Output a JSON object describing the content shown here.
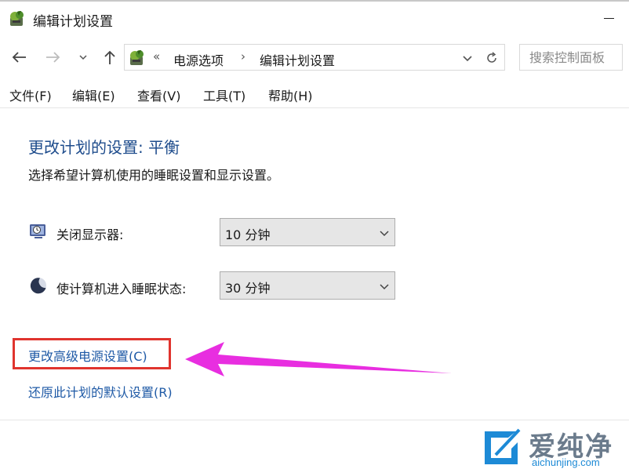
{
  "window": {
    "title": "编辑计划设置"
  },
  "nav": {
    "breadcrumb_sep": "«",
    "crumbs": [
      "电源选项",
      "编辑计划设置"
    ],
    "crumb_arrow": "›",
    "search_placeholder": "搜索控制面板"
  },
  "menu": {
    "items": [
      "文件(F)",
      "编辑(E)",
      "查看(V)",
      "工具(T)",
      "帮助(H)"
    ]
  },
  "main": {
    "heading": "更改计划的设置: 平衡",
    "subtext": "选择希望计算机使用的睡眠设置和显示设置。",
    "settings": [
      {
        "label": "关闭显示器:",
        "value": "10 分钟",
        "icon": "display-off-icon"
      },
      {
        "label": "使计算机进入睡眠状态:",
        "value": "30 分钟",
        "icon": "sleep-moon-icon"
      }
    ],
    "links": {
      "advanced": "更改高级电源设置(C)",
      "restore": "还原此计划的默认设置(R)"
    }
  },
  "colors": {
    "heading": "#1e4c8c",
    "link": "#1f5aa6",
    "highlight_border": "#e0342e",
    "arrow": "#e82ee0"
  },
  "watermark": {
    "name": "爱纯净",
    "url": "aichunjing.com"
  }
}
